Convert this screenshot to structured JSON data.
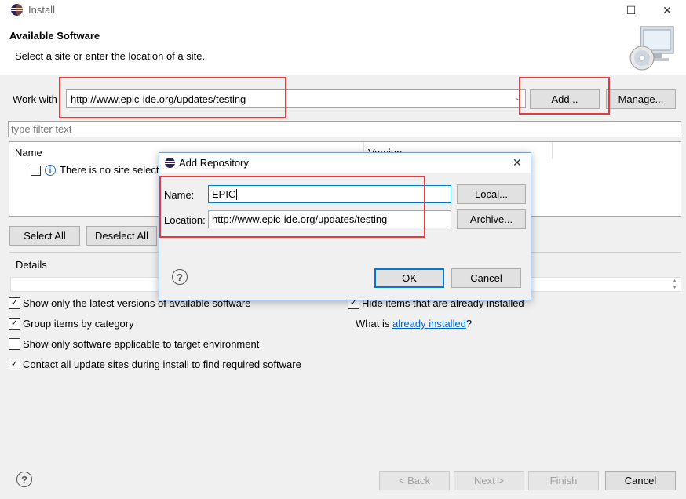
{
  "window": {
    "title": "Install"
  },
  "header": {
    "title": "Available Software",
    "subtitle": "Select a site or enter the location of a site."
  },
  "work_with": {
    "label": "Work with",
    "value": "http://www.epic-ide.org/updates/testing",
    "add_label": "Add...",
    "manage_label": "Manage..."
  },
  "filter": {
    "placeholder": "type filter text"
  },
  "table": {
    "col_name": "Name",
    "col_version": "Version",
    "empty_message": "There is no site select"
  },
  "buttons": {
    "select_all": "Select All",
    "deselect_all": "Deselect All"
  },
  "details": {
    "label": "Details"
  },
  "options": [
    {
      "label": "Show only the latest versions of available software",
      "checked": true
    },
    {
      "label": "Group items by category",
      "checked": true
    },
    {
      "label": "Show only software applicable to target environment",
      "checked": false
    },
    {
      "label": "Contact all update sites during install to find required software",
      "checked": true
    }
  ],
  "right_options": {
    "hide_label": "Hide items that are already installed",
    "what_is": "What is",
    "already_installed": "already installed",
    "question": "?"
  },
  "footer": {
    "back": "< Back",
    "next": "Next >",
    "finish": "Finish",
    "cancel": "Cancel"
  },
  "dialog": {
    "title": "Add Repository",
    "name_label": "Name:",
    "name_value": "EPIC",
    "location_label": "Location:",
    "location_value": "http://www.epic-ide.org/updates/testing",
    "local_label": "Local...",
    "archive_label": "Archive...",
    "ok_label": "OK",
    "cancel_label": "Cancel"
  },
  "colors": {
    "highlight": "#e5393e",
    "link": "#0066cc",
    "focus": "#0078d7"
  }
}
